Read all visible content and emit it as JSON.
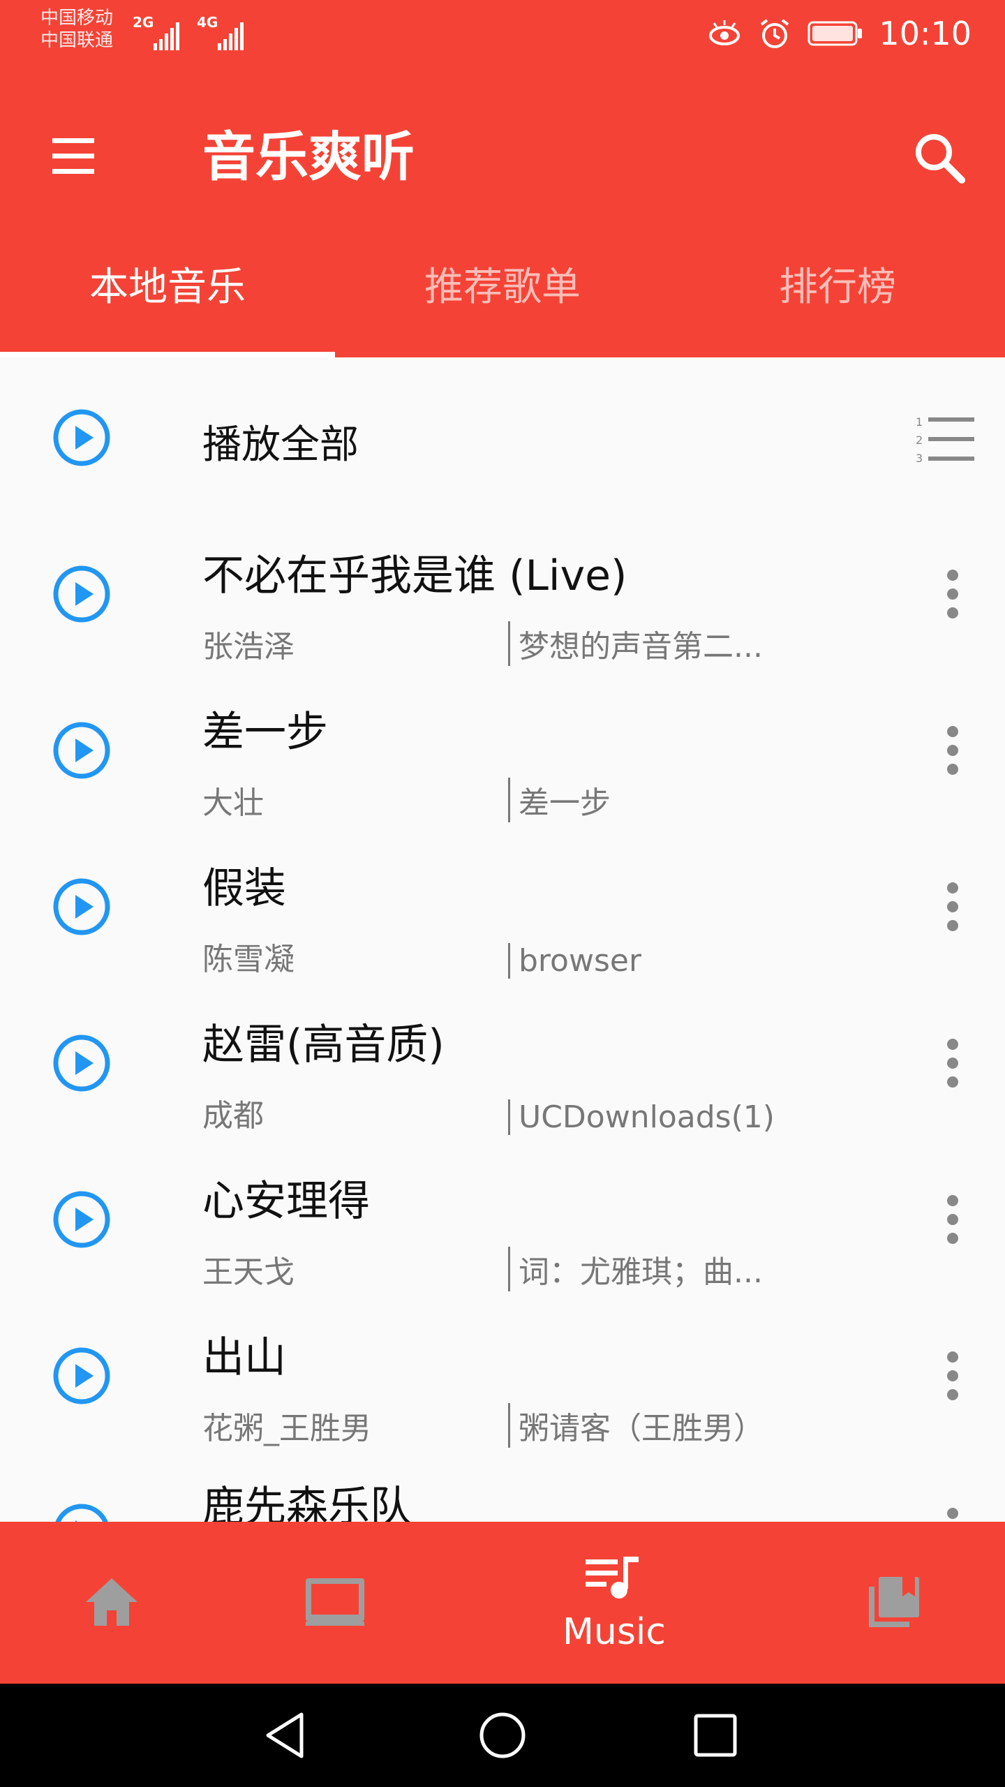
{
  "status_bar": {
    "carrier_1": "中国移动",
    "carrier_2": "中国联通",
    "net_1": "2G",
    "net_2": "4G",
    "time": "10:10",
    "icons": [
      "eye-icon",
      "alarm-icon",
      "battery-icon"
    ]
  },
  "app_bar": {
    "title": "音乐爽听",
    "menu_icon": "menu-icon",
    "search_icon": "search-icon"
  },
  "tabs": [
    {
      "label": "本地音乐",
      "selected": true
    },
    {
      "label": "推荐歌单",
      "selected": false
    },
    {
      "label": "排行榜",
      "selected": false
    }
  ],
  "play_all": {
    "label": "播放全部",
    "sort_icon": "numbered-list-icon"
  },
  "songs": [
    {
      "title": "不必在乎我是谁 (Live)",
      "artist": "张浩泽",
      "album": "梦想的声音第二..."
    },
    {
      "title": "差一步",
      "artist": "大壮",
      "album": "差一步"
    },
    {
      "title": "假装",
      "artist": "陈雪凝",
      "album": "browser"
    },
    {
      "title": "赵雷(高音质)",
      "artist": "成都",
      "album": "UCDownloads(1)"
    },
    {
      "title": " 心安理得",
      "artist": "王天戈",
      "album": "词：尤雅琪；曲..."
    },
    {
      "title": " 出山",
      "artist": "花粥_王胜男",
      "album": "粥请客（王胜男）"
    },
    {
      "title": "鹿先森乐队",
      "artist": "",
      "album": ""
    }
  ],
  "bottom_nav": [
    {
      "icon": "home-icon",
      "label": "",
      "selected": false
    },
    {
      "icon": "tv-icon",
      "label": "",
      "selected": false
    },
    {
      "icon": "music-queue-icon",
      "label": "Music",
      "selected": true
    },
    {
      "icon": "library-icon",
      "label": "",
      "selected": false
    }
  ],
  "colors": {
    "primary": "#f44336",
    "play_blue": "#2196f3",
    "inactive_icon": "#9e9e9e"
  }
}
